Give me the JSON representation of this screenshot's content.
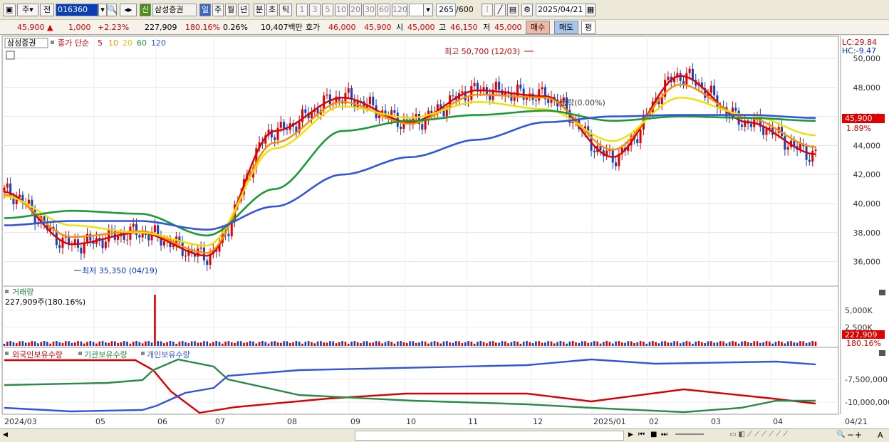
{
  "toolbar": {
    "market_btn": "주",
    "type_btn": "전",
    "code": "016360",
    "stock_name": "삼성증권",
    "credit_badge": "신",
    "periods": [
      "일",
      "주",
      "월",
      "년",
      "분",
      "초",
      "틱"
    ],
    "active_period": "일",
    "intervals": [
      "1",
      "3",
      "5",
      "10",
      "20",
      "30",
      "60",
      "120"
    ],
    "count": "265",
    "count_total": "/600",
    "date": "2025/04/21"
  },
  "quote": {
    "price": "45,900",
    "change": "1,000",
    "change_pct": "+2.23%",
    "volume": "227,909",
    "volume_ratio": "180.16%",
    "turnover": "0.26%",
    "amount": "10,407백만",
    "ask_label": "호가",
    "ask": "46,000",
    "bid": "45,900",
    "open_label": "시",
    "open": "45,000",
    "high_label": "고",
    "high": "46,150",
    "low_label": "저",
    "low": "45,000",
    "buy_btn": "매수",
    "sell_btn": "매도",
    "eval_btn": "평"
  },
  "price_panel": {
    "name_label": "삼성증권",
    "legend_title": "종가 단순",
    "ma_labels": [
      "5",
      "10",
      "20",
      "60",
      "120"
    ],
    "lc_label": "LC:29.84",
    "hc_label": "HC:-9.47",
    "high_note": "최고 50,700 (12/03)",
    "low_note": "최저 35,350 (04/19)",
    "pct_note": "등락(0.00%)",
    "last_price": "45,900",
    "last_pct": "1.89%",
    "yticks": [
      "50,000",
      "48,000",
      "46,000",
      "44,000",
      "42,000",
      "40,000",
      "38,000",
      "36,000"
    ]
  },
  "volume_panel": {
    "title": "거래량",
    "value": "227,909주(180.16%)",
    "yticks": [
      "5,000K",
      "2,500K"
    ],
    "last": "227,909",
    "last_pct": "180.16%"
  },
  "holding_panel": {
    "legend": [
      "외국인보유수량",
      "기관보유수량",
      "개인보유수량"
    ],
    "yticks": [
      "-7,500,000",
      "-10,000,000"
    ]
  },
  "xaxis": [
    "2024/03",
    "05",
    "06",
    "07",
    "08",
    "09",
    "10",
    "11",
    "12",
    "2025/01",
    "02",
    "03",
    "04",
    "04/21"
  ],
  "colors": {
    "ma5": "#e00000",
    "ma10": "#ff8c00",
    "ma20": "#f0e000",
    "ma60": "#1a9a3a",
    "ma120": "#3355dd",
    "up": "#e00000",
    "down": "#1a3fbf"
  },
  "chart_data": {
    "type": "line",
    "x": [
      "2024/03",
      "05",
      "06",
      "07",
      "08",
      "09",
      "10",
      "11",
      "12",
      "2025/01",
      "02",
      "03",
      "04"
    ],
    "series": [
      {
        "name": "5",
        "values": [
          40800,
          37200,
          38000,
          36400,
          45000,
          47300,
          45600,
          47800,
          47400,
          43200,
          48800,
          45600,
          43400
        ]
      },
      {
        "name": "10",
        "values": [
          40600,
          37700,
          38100,
          36600,
          44200,
          47000,
          45500,
          47500,
          47300,
          43700,
          48200,
          45900,
          43900
        ]
      },
      {
        "name": "20",
        "values": [
          40500,
          38500,
          38000,
          37100,
          43800,
          46700,
          45900,
          47000,
          46500,
          44300,
          47300,
          46100,
          44700
        ]
      },
      {
        "name": "60",
        "values": [
          39000,
          39500,
          39300,
          37800,
          41000,
          45000,
          45700,
          46100,
          46400,
          45700,
          46000,
          45900,
          45700
        ]
      },
      {
        "name": "120",
        "values": [
          38500,
          38800,
          38800,
          38200,
          39800,
          42000,
          43200,
          44400,
          45600,
          46000,
          46100,
          46100,
          45900
        ]
      }
    ],
    "ylim": [
      35000,
      51000
    ]
  }
}
